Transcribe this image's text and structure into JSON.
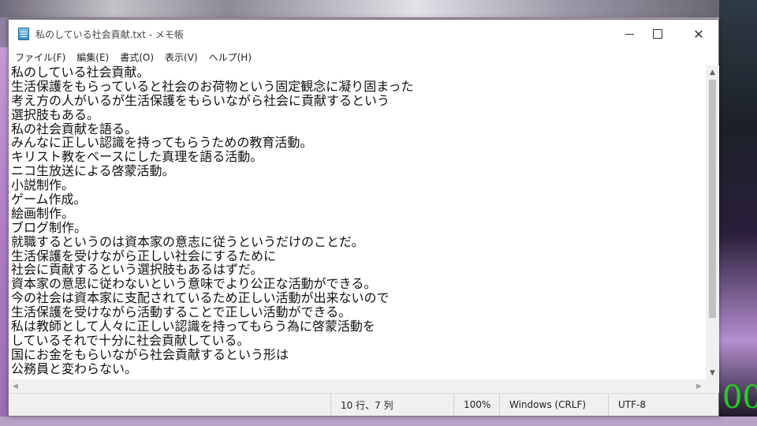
{
  "window": {
    "title": "私のしている社会貢献.txt - メモ帳"
  },
  "menu": [
    {
      "label": "ファイル(F)"
    },
    {
      "label": "編集(E)"
    },
    {
      "label": "書式(O)"
    },
    {
      "label": "表示(V)"
    },
    {
      "label": "ヘルプ(H)"
    }
  ],
  "editor": {
    "lines": [
      "私のしている社会貢献。",
      "生活保護をもらっていると社会のお荷物という固定観念に凝り固まった",
      "考え方の人がいるが生活保護をもらいながら社会に貢献するという",
      "選択肢もある。",
      "私の社会貢献を語る。",
      "みんなに正しい認識を持ってもらうための教育活動。",
      "キリスト教をベースにした真理を語る活動。",
      "ニコ生放送による啓蒙活動。",
      "小説制作。",
      "ゲーム作成。",
      "絵画制作。",
      "ブログ制作。",
      "就職するというのは資本家の意志に従うというだけのことだ。",
      "生活保護を受けながら正しい社会にするために",
      "社会に貢献するという選択肢もあるはずだ。",
      "資本家の意思に従わないという意味でより公正な活動ができる。",
      "今の社会は資本家に支配されているため正しい活動が出来ないので",
      "生活保護を受けながら活動することで正しい活動ができる。",
      "私は教師として人々に正しい認識を持ってもらう為に啓蒙活動を",
      "しているそれで十分に社会貢献している。",
      "国にお金をもらいながら社会貢献するという形は",
      "公務員と変わらない。"
    ]
  },
  "status": {
    "position": "10 行、7 列",
    "zoom": "100%",
    "line_ending": "Windows (CRLF)",
    "encoding": "UTF-8"
  },
  "background": {
    "digits": "00"
  },
  "icons": {
    "app": "notepad-icon",
    "minimize": "minimize-icon",
    "maximize": "maximize-icon",
    "close": "close-icon"
  }
}
